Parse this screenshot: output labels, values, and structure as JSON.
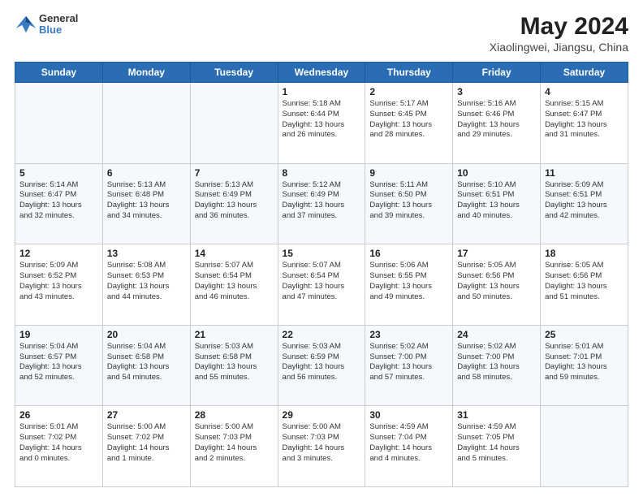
{
  "header": {
    "logo": {
      "line1": "General",
      "line2": "Blue"
    },
    "title": "May 2024",
    "location": "Xiaolingwei, Jiangsu, China"
  },
  "days_of_week": [
    "Sunday",
    "Monday",
    "Tuesday",
    "Wednesday",
    "Thursday",
    "Friday",
    "Saturday"
  ],
  "weeks": [
    [
      {
        "day": "",
        "info": ""
      },
      {
        "day": "",
        "info": ""
      },
      {
        "day": "",
        "info": ""
      },
      {
        "day": "1",
        "info": "Sunrise: 5:18 AM\nSunset: 6:44 PM\nDaylight: 13 hours\nand 26 minutes."
      },
      {
        "day": "2",
        "info": "Sunrise: 5:17 AM\nSunset: 6:45 PM\nDaylight: 13 hours\nand 28 minutes."
      },
      {
        "day": "3",
        "info": "Sunrise: 5:16 AM\nSunset: 6:46 PM\nDaylight: 13 hours\nand 29 minutes."
      },
      {
        "day": "4",
        "info": "Sunrise: 5:15 AM\nSunset: 6:47 PM\nDaylight: 13 hours\nand 31 minutes."
      }
    ],
    [
      {
        "day": "5",
        "info": "Sunrise: 5:14 AM\nSunset: 6:47 PM\nDaylight: 13 hours\nand 32 minutes."
      },
      {
        "day": "6",
        "info": "Sunrise: 5:13 AM\nSunset: 6:48 PM\nDaylight: 13 hours\nand 34 minutes."
      },
      {
        "day": "7",
        "info": "Sunrise: 5:13 AM\nSunset: 6:49 PM\nDaylight: 13 hours\nand 36 minutes."
      },
      {
        "day": "8",
        "info": "Sunrise: 5:12 AM\nSunset: 6:49 PM\nDaylight: 13 hours\nand 37 minutes."
      },
      {
        "day": "9",
        "info": "Sunrise: 5:11 AM\nSunset: 6:50 PM\nDaylight: 13 hours\nand 39 minutes."
      },
      {
        "day": "10",
        "info": "Sunrise: 5:10 AM\nSunset: 6:51 PM\nDaylight: 13 hours\nand 40 minutes."
      },
      {
        "day": "11",
        "info": "Sunrise: 5:09 AM\nSunset: 6:51 PM\nDaylight: 13 hours\nand 42 minutes."
      }
    ],
    [
      {
        "day": "12",
        "info": "Sunrise: 5:09 AM\nSunset: 6:52 PM\nDaylight: 13 hours\nand 43 minutes."
      },
      {
        "day": "13",
        "info": "Sunrise: 5:08 AM\nSunset: 6:53 PM\nDaylight: 13 hours\nand 44 minutes."
      },
      {
        "day": "14",
        "info": "Sunrise: 5:07 AM\nSunset: 6:54 PM\nDaylight: 13 hours\nand 46 minutes."
      },
      {
        "day": "15",
        "info": "Sunrise: 5:07 AM\nSunset: 6:54 PM\nDaylight: 13 hours\nand 47 minutes."
      },
      {
        "day": "16",
        "info": "Sunrise: 5:06 AM\nSunset: 6:55 PM\nDaylight: 13 hours\nand 49 minutes."
      },
      {
        "day": "17",
        "info": "Sunrise: 5:05 AM\nSunset: 6:56 PM\nDaylight: 13 hours\nand 50 minutes."
      },
      {
        "day": "18",
        "info": "Sunrise: 5:05 AM\nSunset: 6:56 PM\nDaylight: 13 hours\nand 51 minutes."
      }
    ],
    [
      {
        "day": "19",
        "info": "Sunrise: 5:04 AM\nSunset: 6:57 PM\nDaylight: 13 hours\nand 52 minutes."
      },
      {
        "day": "20",
        "info": "Sunrise: 5:04 AM\nSunset: 6:58 PM\nDaylight: 13 hours\nand 54 minutes."
      },
      {
        "day": "21",
        "info": "Sunrise: 5:03 AM\nSunset: 6:58 PM\nDaylight: 13 hours\nand 55 minutes."
      },
      {
        "day": "22",
        "info": "Sunrise: 5:03 AM\nSunset: 6:59 PM\nDaylight: 13 hours\nand 56 minutes."
      },
      {
        "day": "23",
        "info": "Sunrise: 5:02 AM\nSunset: 7:00 PM\nDaylight: 13 hours\nand 57 minutes."
      },
      {
        "day": "24",
        "info": "Sunrise: 5:02 AM\nSunset: 7:00 PM\nDaylight: 13 hours\nand 58 minutes."
      },
      {
        "day": "25",
        "info": "Sunrise: 5:01 AM\nSunset: 7:01 PM\nDaylight: 13 hours\nand 59 minutes."
      }
    ],
    [
      {
        "day": "26",
        "info": "Sunrise: 5:01 AM\nSunset: 7:02 PM\nDaylight: 14 hours\nand 0 minutes."
      },
      {
        "day": "27",
        "info": "Sunrise: 5:00 AM\nSunset: 7:02 PM\nDaylight: 14 hours\nand 1 minute."
      },
      {
        "day": "28",
        "info": "Sunrise: 5:00 AM\nSunset: 7:03 PM\nDaylight: 14 hours\nand 2 minutes."
      },
      {
        "day": "29",
        "info": "Sunrise: 5:00 AM\nSunset: 7:03 PM\nDaylight: 14 hours\nand 3 minutes."
      },
      {
        "day": "30",
        "info": "Sunrise: 4:59 AM\nSunset: 7:04 PM\nDaylight: 14 hours\nand 4 minutes."
      },
      {
        "day": "31",
        "info": "Sunrise: 4:59 AM\nSunset: 7:05 PM\nDaylight: 14 hours\nand 5 minutes."
      },
      {
        "day": "",
        "info": ""
      }
    ]
  ]
}
